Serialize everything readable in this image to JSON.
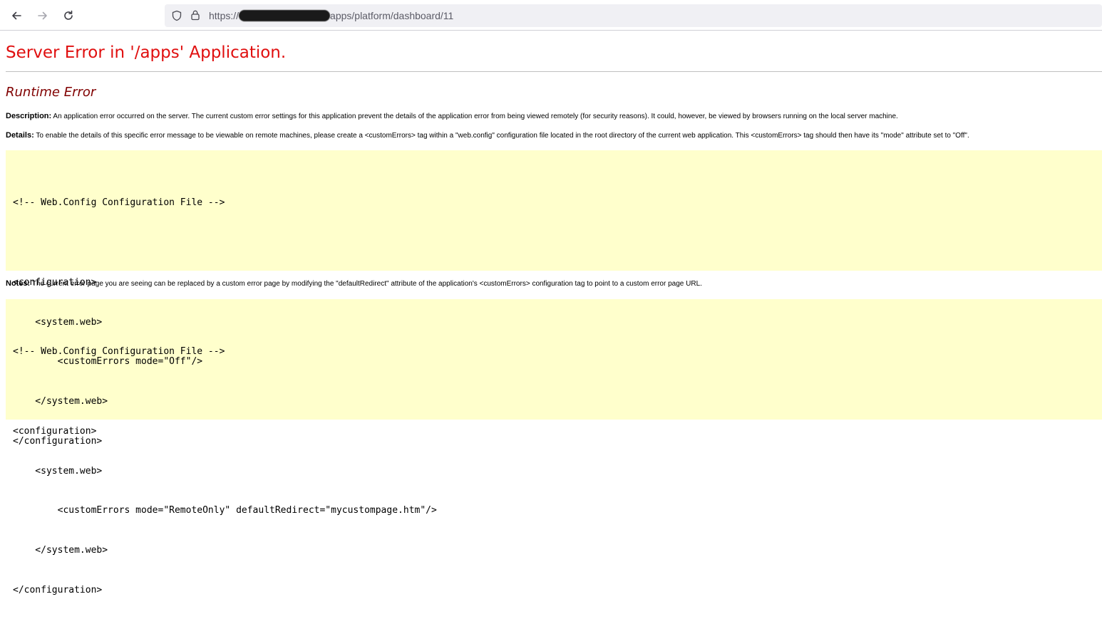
{
  "browser": {
    "back_icon": "arrow-left-icon",
    "forward_icon": "arrow-right-icon",
    "reload_icon": "reload-icon",
    "url_prefix": "https://",
    "url_suffix": "apps/platform/dashboard/11"
  },
  "page": {
    "title": "Server Error in '/apps' Application.",
    "subtitle": "Runtime Error",
    "description_label": "Description:",
    "description_text": " An application error occurred on the server. The current custom error settings for this application prevent the details of the application error from being viewed remotely (for security reasons). It could, however, be viewed by browsers running on the local server machine.",
    "details_label": "Details:",
    "details_text": " To enable the details of this specific error message to be viewable on remote machines, please create a <customErrors> tag within a \"web.config\" configuration file located in the root directory of the current web application. This <customErrors> tag should then have its \"mode\" attribute set to \"Off\".",
    "code_block_1": [
      "<!-- Web.Config Configuration File -->",
      "",
      "<configuration>",
      "    <system.web>",
      "        <customErrors mode=\"Off\"/>",
      "    </system.web>",
      "</configuration>"
    ],
    "notes_label": "Notes:",
    "notes_text": " The current error page you are seeing can be replaced by a custom error page by modifying the \"defaultRedirect\" attribute of the application's <customErrors> configuration tag to point to a custom error page URL.",
    "code_block_2": [
      "<!-- Web.Config Configuration File -->",
      "",
      "<configuration>",
      "    <system.web>",
      "        <customErrors mode=\"RemoteOnly\" defaultRedirect=\"mycustompage.htm\"/>",
      "    </system.web>",
      "</configuration>"
    ]
  },
  "colors": {
    "title": "#e00f0f",
    "subtitle": "#800000",
    "code_background": "#ffffcc"
  }
}
